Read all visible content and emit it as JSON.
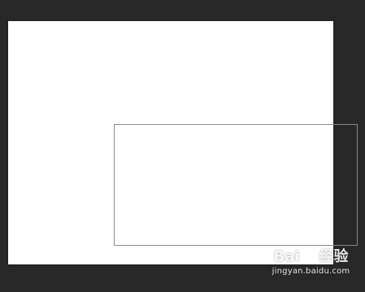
{
  "workspace": {
    "background_color": "#282828"
  },
  "canvas": {
    "background_color": "#ffffff"
  },
  "selection": {
    "border_color": "#8a8a8a"
  },
  "watermark": {
    "brand_left": "Bai",
    "icon": "paw-icon",
    "brand_right": "经验",
    "url": "jingyan.baidu.com"
  }
}
